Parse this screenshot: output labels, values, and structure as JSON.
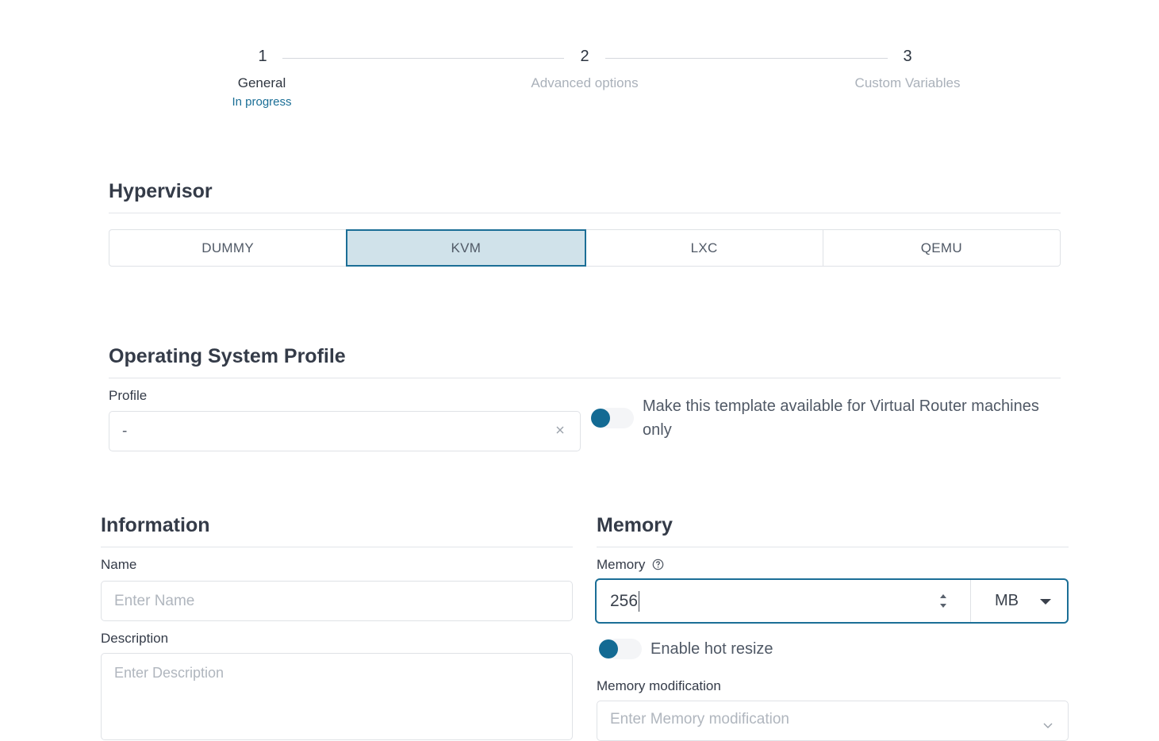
{
  "stepper": {
    "steps": [
      {
        "number": "1",
        "label": "General",
        "status": "In progress"
      },
      {
        "number": "2",
        "label": "Advanced options"
      },
      {
        "number": "3",
        "label": "Custom Variables"
      }
    ]
  },
  "hypervisor": {
    "title": "Hypervisor",
    "options": [
      "DUMMY",
      "KVM",
      "LXC",
      "QEMU"
    ],
    "selected": "KVM"
  },
  "os_profile": {
    "title": "Operating System Profile",
    "profile_label": "Profile",
    "profile_value": "-",
    "vrouter_toggle_label": "Make this template available for Virtual Router machines only"
  },
  "information": {
    "title": "Information",
    "name_label": "Name",
    "name_placeholder": "Enter Name",
    "description_label": "Description",
    "description_placeholder": "Enter Description"
  },
  "memory": {
    "title": "Memory",
    "memory_label": "Memory",
    "memory_value": "256",
    "unit": "MB",
    "hot_resize_label": "Enable hot resize",
    "modification_label": "Memory modification",
    "modification_placeholder": "Enter Memory modification"
  },
  "colors": {
    "accent": "#1b6e96",
    "selected_bg": "#d0e2ea"
  }
}
